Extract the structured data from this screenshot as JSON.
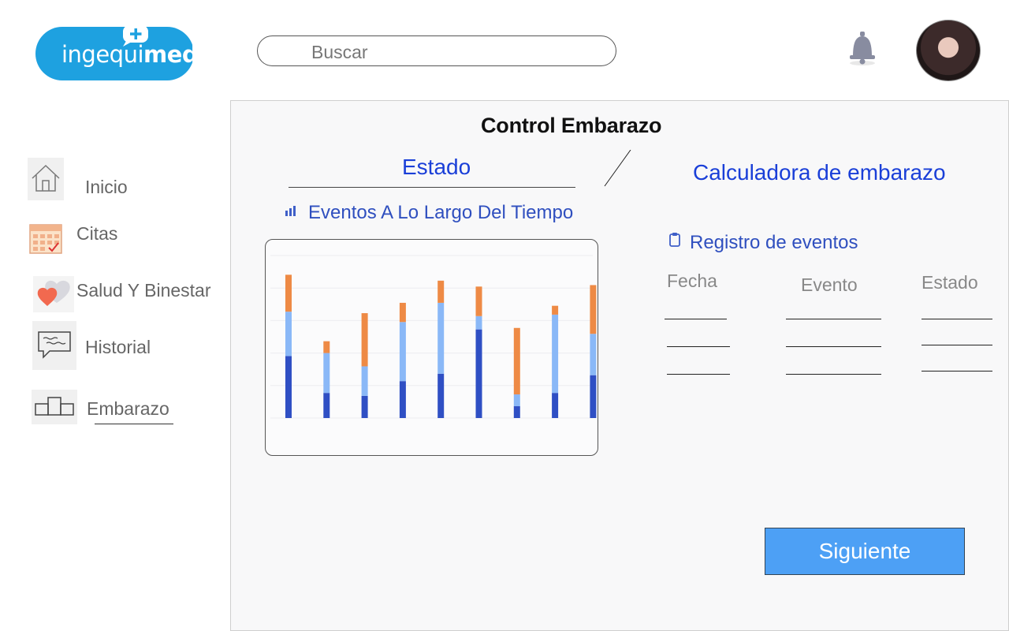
{
  "brand": {
    "logo_light": "ingequi",
    "logo_bold": "med"
  },
  "search": {
    "placeholder": "Buscar"
  },
  "sidebar": {
    "items": [
      {
        "label": "Inicio",
        "icon": "home-icon"
      },
      {
        "label": "Citas",
        "icon": "calendar-icon"
      },
      {
        "label": "Salud Y Binestar",
        "icon": "heart-icon"
      },
      {
        "label": "Historial",
        "icon": "chat-icon"
      },
      {
        "label": "Embarazo",
        "icon": "podium-icon"
      }
    ],
    "active": "Embarazo"
  },
  "main": {
    "title": "Control Embarazo",
    "tab_estado": "Estado",
    "tab_calculadora": "Calculadora de embarazo",
    "events_title": "Eventos A Lo Largo Del Tiempo",
    "registro_title": "Registro de eventos",
    "table": {
      "headers": [
        "Fecha",
        "Evento",
        "Estado"
      ]
    },
    "next_button": "Siguiente"
  },
  "colors": {
    "brand": "#1ea1e0",
    "accent_text": "#1a3fd8",
    "button": "#4da0f5",
    "bar_dark": "#2f4fc4",
    "bar_light": "#8ab8f7",
    "bar_orange": "#ee8a45"
  },
  "chart_data": {
    "type": "bar",
    "stacked": true,
    "categories": [
      "",
      "",
      "",
      "",
      "",
      "",
      "",
      "",
      ""
    ],
    "series": [
      {
        "values": [
          42,
          17,
          15,
          25,
          30,
          60,
          8,
          17,
          29
        ]
      },
      {
        "values": [
          30,
          27,
          20,
          40,
          48,
          9,
          8,
          53,
          28
        ]
      },
      {
        "values": [
          25,
          8,
          36,
          13,
          15,
          20,
          45,
          6,
          33
        ]
      }
    ],
    "ylim": [
      0,
      110
    ],
    "grid": true
  }
}
